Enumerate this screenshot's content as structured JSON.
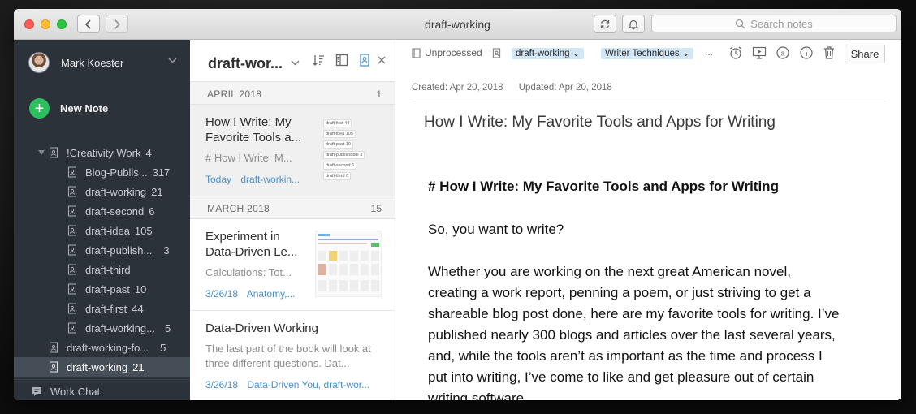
{
  "window": {
    "title": "draft-working"
  },
  "search": {
    "placeholder": "Search notes"
  },
  "sidebar": {
    "user_name": "Mark Koester",
    "new_note_label": "New Note",
    "stack": {
      "label": "!Creativity Work",
      "count": "4"
    },
    "notebooks": [
      {
        "label": "Blog-Publis...",
        "count": "317"
      },
      {
        "label": "draft-working",
        "count": "21"
      },
      {
        "label": "draft-second",
        "count": "6"
      },
      {
        "label": "draft-idea",
        "count": "105"
      },
      {
        "label": "draft-publish...",
        "count": "3"
      },
      {
        "label": "draft-third",
        "count": ""
      },
      {
        "label": "draft-past",
        "count": "10"
      },
      {
        "label": "draft-first",
        "count": "44"
      },
      {
        "label": "draft-working...",
        "count": "5"
      }
    ],
    "extra_notebooks": [
      {
        "label": "draft-working-fo...",
        "count": "5"
      },
      {
        "label": "draft-working",
        "count": "21"
      }
    ],
    "work_chat_label": "Work Chat"
  },
  "notelist": {
    "title": "draft-wor...",
    "sections": [
      {
        "label": "APRIL 2018",
        "count": "1"
      },
      {
        "label": "MARCH 2018",
        "count": "15"
      }
    ],
    "notes": [
      {
        "title": "How I Write: My Favorite Tools a...",
        "snippet": "# How I Write: M...",
        "date": "Today",
        "tags": "draft-workin...",
        "thumb_tags": [
          "draft-first  44",
          "draft-idea  105",
          "draft-past  10",
          "draft-publishable  3",
          "draft-second  6",
          "draft-third  0"
        ]
      },
      {
        "title": "Experiment in Data-Driven Le...",
        "snippet": "Calculations: Tot...",
        "date": "3/26/18",
        "tags": "Anatomy,..."
      },
      {
        "title": "Data-Driven Working",
        "snippet": "The last part of the book will look at three different questions. Dat...",
        "date": "3/26/18",
        "tags": "Data-Driven You, draft-wor..."
      }
    ]
  },
  "editor": {
    "unprocessed_label": "Unprocessed",
    "tags": [
      "draft-working",
      "Writer Techniques"
    ],
    "more_tags": "...",
    "share_label": "Share",
    "created": "Created: Apr 20, 2018",
    "updated": "Updated: Apr 20, 2018",
    "note_title": "How I Write: My Favorite Tools and Apps for Writing",
    "heading": "# How I Write: My Favorite Tools and Apps for Writing",
    "para1": "So, you want to write?",
    "para2_lines": [
      "Whether you are working on the next great American novel,",
      "creating a work report, penning a poem, or just striving to get a",
      "shareable blog post done, here are my favorite tools for writing. I’ve",
      "published nearly 300 blogs and articles over the last several years,",
      "and, while the tools aren’t as important as the time and process I",
      "put into writing, I’ve come to like and get pleasure out of certain",
      "writing software."
    ]
  },
  "colors": {
    "sidebar_bg": "#2c3239",
    "sidebar_selected": "#454d56",
    "new_note_green": "#2dbe60",
    "tag_pill": "#d3e6f4",
    "meta_blue": "#4a90c4"
  }
}
